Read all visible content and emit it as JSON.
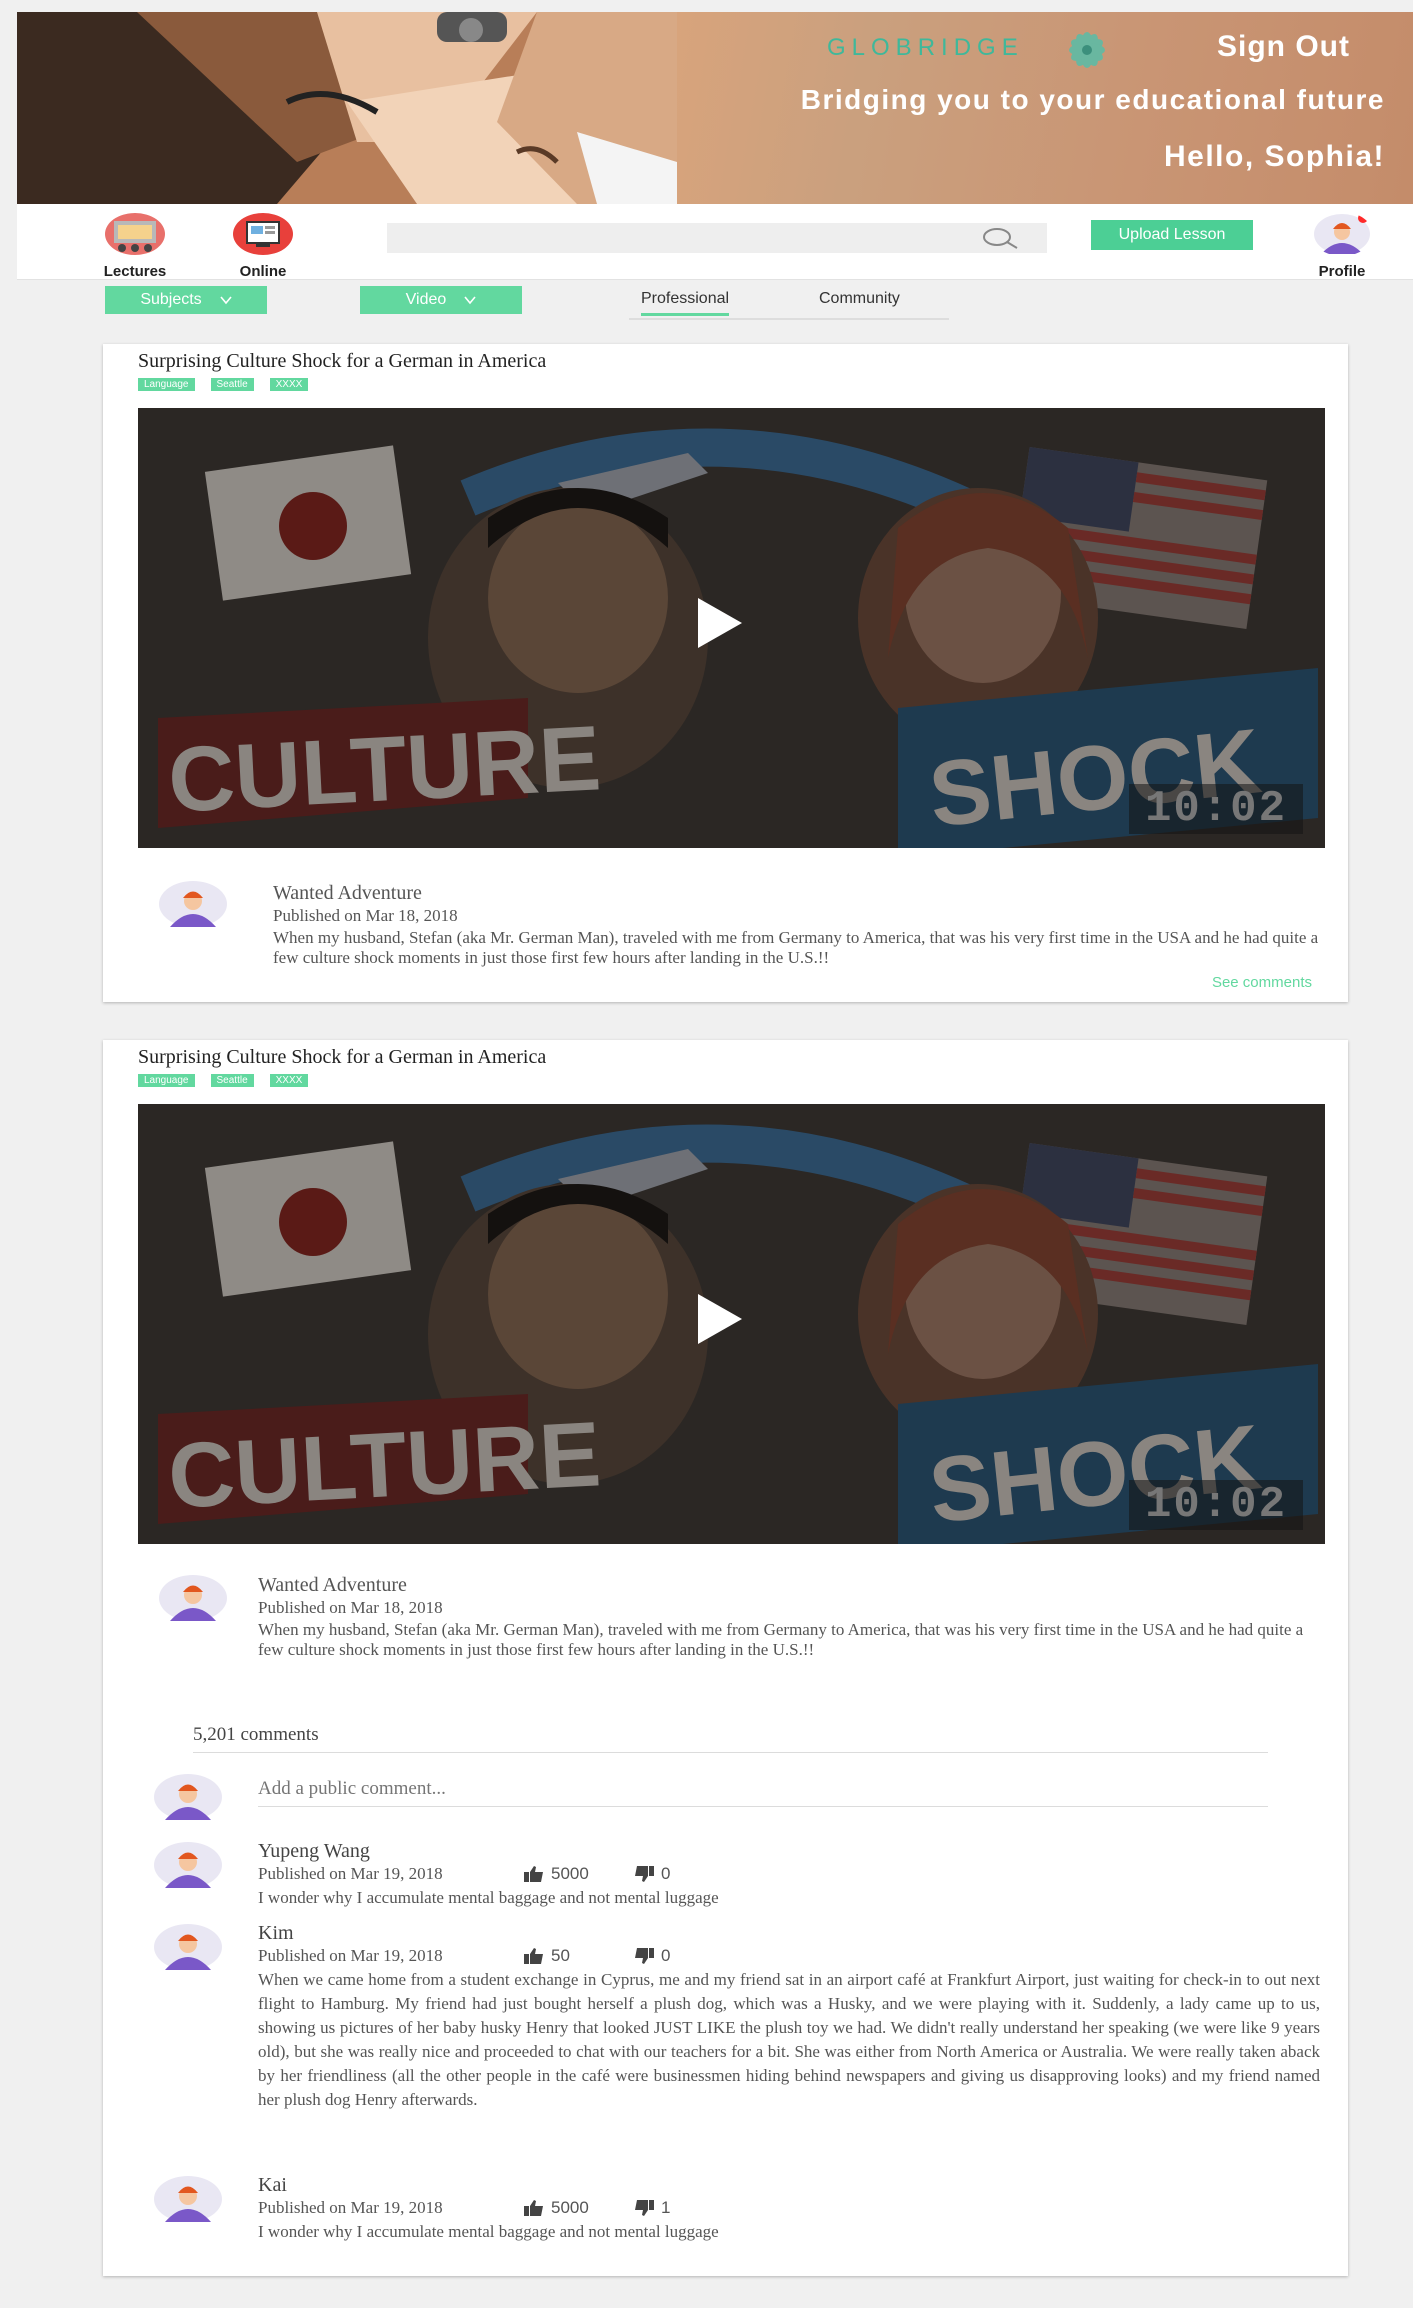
{
  "header": {
    "brand": "GLOBRIDGE",
    "sign_out": "Sign Out",
    "tagline": "Bridging you to your educational  future",
    "greeting": "Hello, Sophia!"
  },
  "nav": {
    "lectures_label": "Lectures",
    "online_label": "Online",
    "search_value": "",
    "upload_label": "Upload Lesson",
    "profile_label": "Profile"
  },
  "filters": {
    "subjects_label": "Subjects",
    "video_label": "Video",
    "tab_professional": "Professional",
    "tab_community": "Community"
  },
  "posts": [
    {
      "title": "Surprising Culture Shock for a German in America",
      "tags": [
        "Language",
        "Seattle",
        "XXXX"
      ],
      "duration": "10:02",
      "author": "Wanted Adventure",
      "published": "Published on Mar 18, 2018",
      "description": "When my husband, Stefan (aka Mr. German Man), traveled with me from Germany to America, that was his very first time in the USA and he had quite a few culture shock moments in just those first few hours after landing in the U.S.!!",
      "see_comments": "See comments"
    },
    {
      "title": "Surprising Culture Shock for a German in America",
      "tags": [
        "Language",
        "Seattle",
        "XXXX"
      ],
      "duration": "10:02",
      "author": "Wanted Adventure",
      "published": "Published on Mar 18, 2018",
      "description": "When my husband, Stefan (aka Mr. German Man), traveled with me from Germany to America, that was his very first time in the USA and he had quite a few culture shock moments in just those first few hours after landing in the U.S.!!",
      "comments_count": "5,201 comments",
      "add_comment_placeholder": "Add a public comment...",
      "comments": [
        {
          "name": "Yupeng Wang",
          "date": "Published on Mar 19, 2018",
          "likes": "5000",
          "dislikes": "0",
          "text": "I wonder why I accumulate mental baggage and not mental luggage"
        },
        {
          "name": "Kim",
          "date": "Published on Mar 19, 2018",
          "likes": "50",
          "dislikes": "0",
          "text": "When we came home from a student exchange in Cyprus, me and my friend sat in an airport café at Frankfurt Airport, just waiting for check-in to out next flight to Hamburg. My friend had just bought herself a plush dog, which was a Husky, and we were playing with it. Suddenly, a lady came up to us, showing us pictures of her baby husky Henry that looked JUST LIKE the plush toy we had. We didn't really understand her speaking (we were like 9 years old), but she was really nice and proceeded to chat with our teachers for a bit. She was either from North America or Australia. We were really taken aback by her friendliness (all the other people in the café were businessmen hiding behind newspapers and giving us disapproving looks) and my friend named her plush dog Henry afterwards."
        },
        {
          "name": "Kai",
          "date": "Published on Mar 19, 2018",
          "likes": "5000",
          "dislikes": "1",
          "text": "I wonder why I accumulate mental baggage and not mental luggage"
        }
      ]
    }
  ],
  "colors": {
    "accent": "#62d89f",
    "brand": "#3fb89a"
  }
}
